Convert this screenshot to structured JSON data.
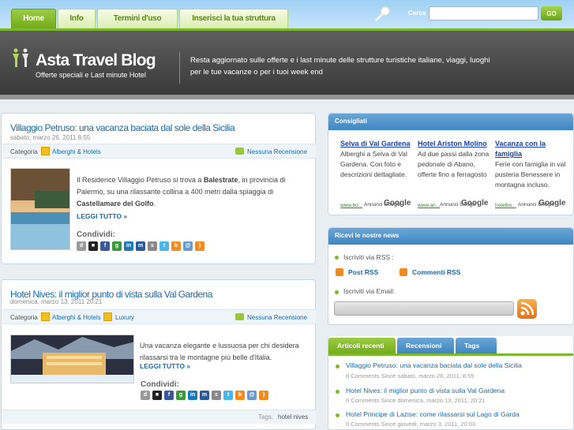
{
  "nav": {
    "tabs": [
      "Home",
      "Info",
      "Termini d'uso",
      "Inserisci la tua struttura"
    ]
  },
  "search": {
    "label": "Cerca",
    "value": "",
    "button": "GO"
  },
  "header": {
    "title": "Asta Travel Blog",
    "subtitle": "Offerte speciali e Last minute Hotel",
    "description": "Resta aggiornato sulle offerte e i last minute delle strutture turistiche italiane, viaggi, luoghi per le tue vacanze o per i tuoi week end"
  },
  "posts": [
    {
      "title": "Villaggio Petruso: una vacanza baciata dal sole della Sicilia",
      "date": "sabato, marzo 26, 2011 8:55",
      "category_label": "Categoria",
      "category": "Alberghi & Hotels",
      "comments": "Nessuna Recensione",
      "text_1": "Il Residence Villaggio Petruso si trova a ",
      "text_bold": "Balestrate",
      "text_2": ", in provincia di Palermo, su una rilassante collina a 400 metri dalla spiaggia di ",
      "text_bold2": "Castellamare del Golfo",
      "text_3": ".",
      "readmore": "LEGGI TUTTO »",
      "share": "Condividi:"
    },
    {
      "title": "Hotel Nives: il miglior punto di vista sulla Val Gardena",
      "date": "domenica, marzo 13, 2011 20:21",
      "category_label": "Categoria",
      "category": "Alberghi & Hotels",
      "category2": "Luxury",
      "comments": "Nessuna Recensione",
      "text": "Una vacanza elegante e lussuosa per chi desidera rilassarsi tra le montagne più belle d'Italia.",
      "readmore": "LEGGI TUTTO »",
      "share": "Condividi:",
      "tags_label": "Tags:",
      "tags": "hotel nives"
    }
  ],
  "sidebar": {
    "consigliati": {
      "title": "Consigliati",
      "ads": [
        {
          "title": "Selva di Val Gardena",
          "text": "Alberghi a Selva di Val Gardena. Con foto e descrizioni dettagliate.",
          "url": "www.bo..."
        },
        {
          "title": "Hotel Ariston Molino",
          "text": "Ad due passi dalla zona pedonale di Abano, offerte fino a ferragosto",
          "url": "www.ari..."
        },
        {
          "title": "Vacanza con la famiglia",
          "text": "Ferie con famiglia in val pusteria Benessere in montagna incluso.",
          "url": "hotelbo..."
        }
      ],
      "adsby": "Annunci Google",
      "glogo": "Google"
    },
    "news": {
      "title": "Ricevi le nostre news",
      "rss_label": "Iscriviti via RSS :",
      "post_rss": "Post RSS",
      "comment_rss": "Commenti RSS",
      "email_label": "Iscriviti via Email:"
    },
    "tabs": [
      "Articoli recenti",
      "Recensioni",
      "Tags"
    ],
    "recent": [
      {
        "title": "Villaggio Petruso: una vacanza baciata dal sole della Sicilia",
        "meta": "0 Comments Since sabato, marzo 26, 2011, 8:55"
      },
      {
        "title": "Hotel Nives: il miglior punto di vista sulla Val Gardena",
        "meta": "0 Comments Since domenica, marzo 13, 2011, 20:21"
      },
      {
        "title": "Hotel Principe di Lazise: come rilassarsi sul Lago di Garda",
        "meta": "0 Comments Since giovedì, marzo 3, 2011, 20:03"
      }
    ]
  },
  "colors": {
    "accent": "#7cb82c",
    "link": "#1a6aa6",
    "header_bg": "#4a4a4a"
  }
}
